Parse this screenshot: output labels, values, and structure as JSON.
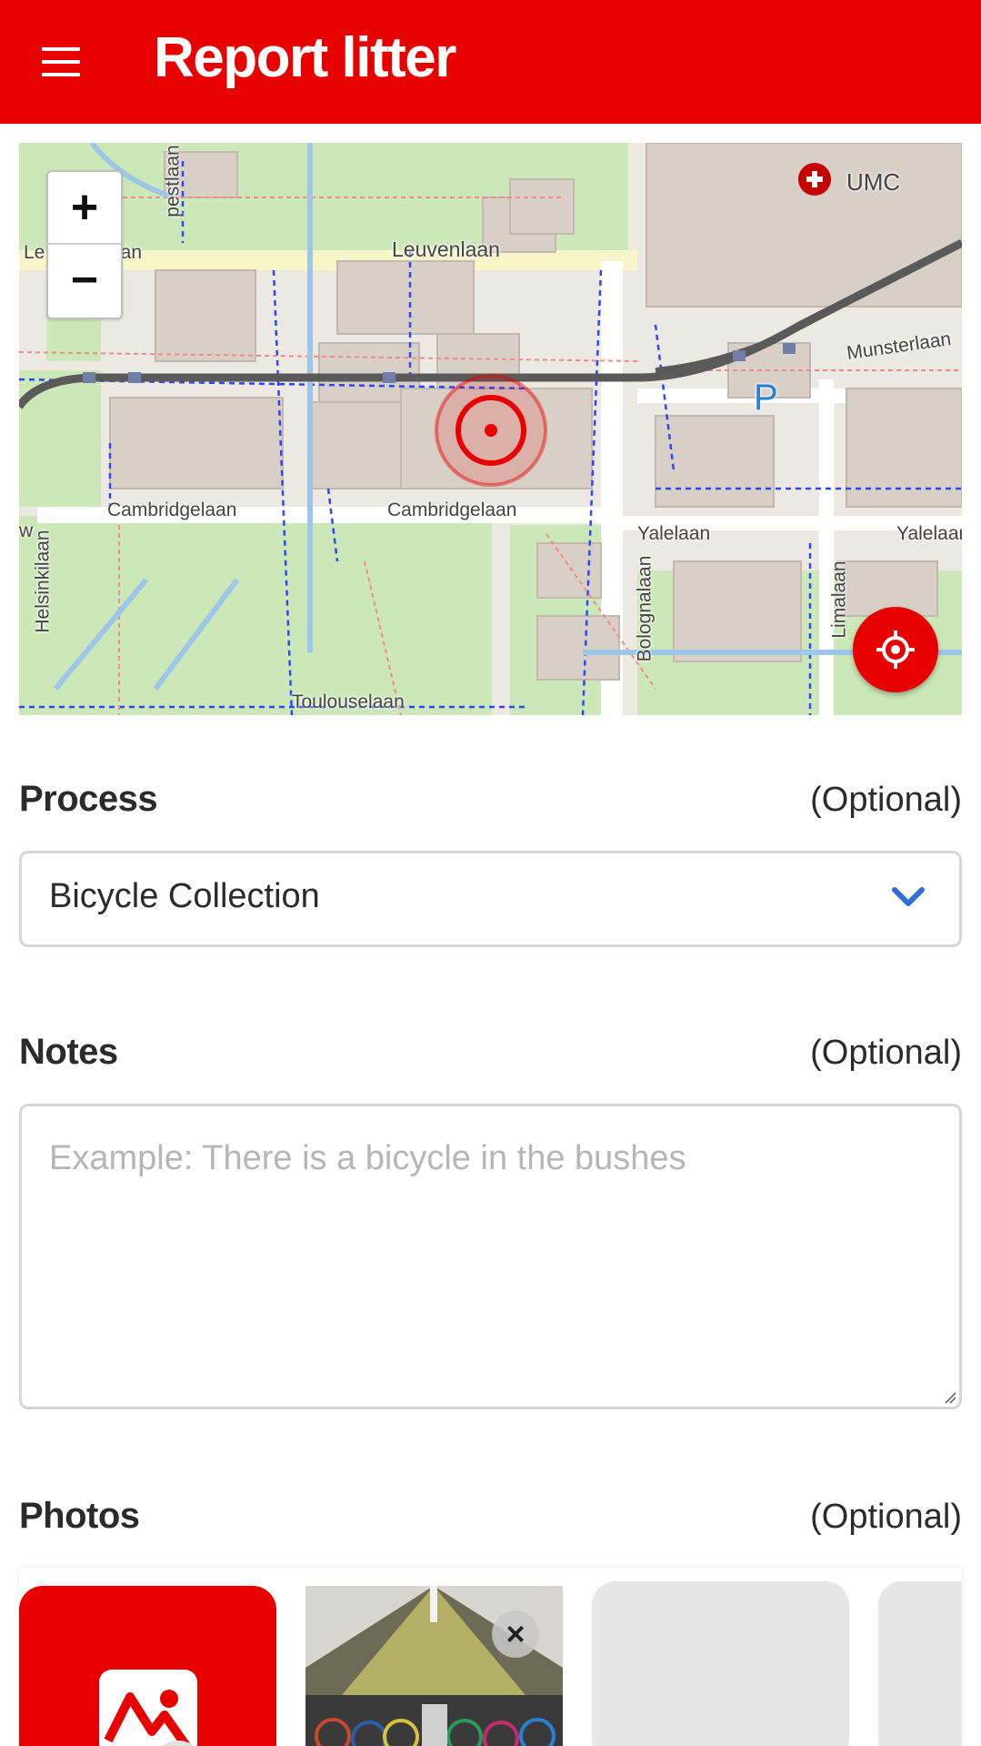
{
  "app_bar": {
    "title": "Report litter",
    "menu_icon": "hamburger-menu-icon",
    "background_color": "#e80000"
  },
  "map": {
    "zoom_in_label": "+",
    "zoom_out_label": "−",
    "locate_icon": "crosshair-icon",
    "marker_icon": "location-marker-icon",
    "streets": [
      "Leuvenlaan",
      "Le",
      "aan",
      "Cambridgelaan",
      "Cambridgelaan",
      "Yalelaan",
      "Yalelaan",
      "Toulouselaan",
      "Helsinkilaan",
      "Bolognalaan",
      "Limalaan",
      "Munsterlaan",
      "pestlaan",
      "w"
    ],
    "pois": [
      "UMC",
      "P"
    ]
  },
  "process": {
    "label": "Process",
    "optional": "(Optional)",
    "selected": "Bicycle Collection",
    "dropdown_icon": "chevron-down-icon"
  },
  "notes": {
    "label": "Notes",
    "optional": "(Optional)",
    "placeholder": "Example: There is a bicycle in the bushes"
  },
  "photos": {
    "label": "Photos",
    "optional": "(Optional)",
    "add_icon": "add-image-icon",
    "remove_label": "×"
  },
  "colors": {
    "accent": "#e80000",
    "chevron": "#2f6fd6",
    "placeholder": "#b6b6b6",
    "border": "#d6d6d6"
  }
}
